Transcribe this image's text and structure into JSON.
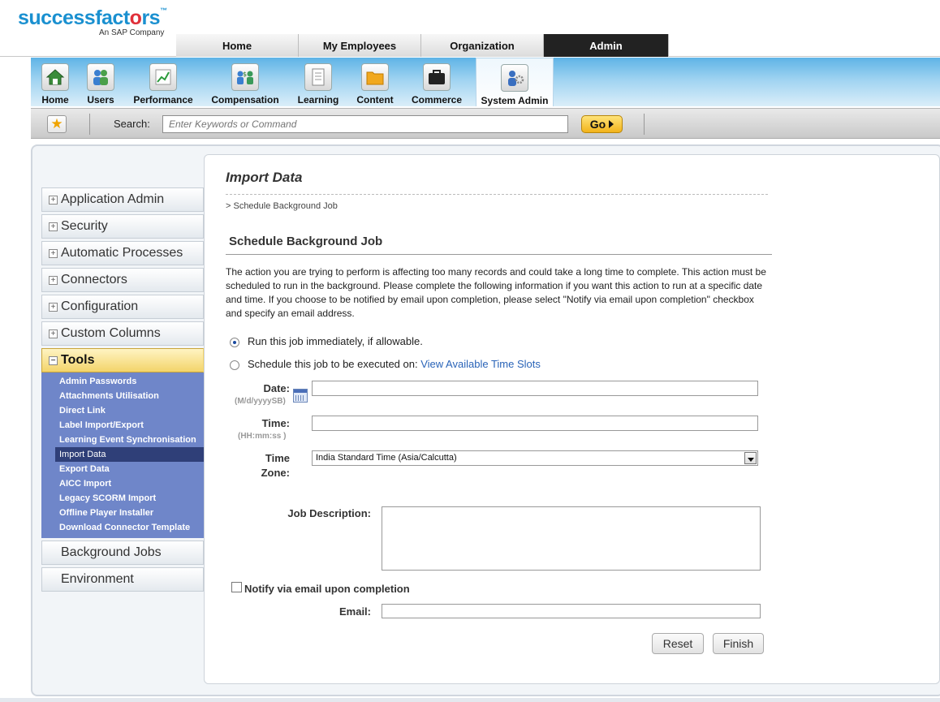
{
  "brand": {
    "logo_part1": "successfact",
    "logo_heart": "o",
    "logo_part2": "rs",
    "tm": "™",
    "sub": "An SAP Company"
  },
  "main_tabs": [
    {
      "label": "Home",
      "active": false
    },
    {
      "label": "My Employees",
      "active": false
    },
    {
      "label": "Organization",
      "active": false
    },
    {
      "label": "Admin",
      "active": true
    }
  ],
  "modules": [
    {
      "label": "Home",
      "icon": "house-icon"
    },
    {
      "label": "Users",
      "icon": "users-icon"
    },
    {
      "label": "Performance",
      "icon": "chart-icon"
    },
    {
      "label": "Compensation",
      "icon": "compensation-icon"
    },
    {
      "label": "Learning",
      "icon": "document-icon"
    },
    {
      "label": "Content",
      "icon": "folder-icon"
    },
    {
      "label": "Commerce",
      "icon": "briefcase-icon"
    },
    {
      "label": "System Admin",
      "icon": "admin-gear-icon",
      "active": true
    }
  ],
  "search": {
    "label": "Search:",
    "placeholder": "Enter Keywords or Command",
    "go_label": "Go"
  },
  "sidebar": {
    "items_top": [
      {
        "label": "Application Admin"
      },
      {
        "label": "Security"
      },
      {
        "label": "Automatic Processes"
      },
      {
        "label": "Connectors"
      },
      {
        "label": "Configuration"
      },
      {
        "label": "Custom Columns"
      }
    ],
    "expanded": {
      "label": "Tools"
    },
    "sub_items": [
      {
        "label": "Admin Passwords"
      },
      {
        "label": "Attachments Utilisation"
      },
      {
        "label": "Direct Link"
      },
      {
        "label": "Label Import/Export"
      },
      {
        "label": "Learning Event Synchronisation"
      },
      {
        "label": "Import Data",
        "active": true
      },
      {
        "label": "Export Data"
      },
      {
        "label": "AICC Import"
      },
      {
        "label": "Legacy SCORM Import"
      },
      {
        "label": "Offline Player Installer"
      },
      {
        "label": "Download Connector Template"
      }
    ],
    "items_bottom": [
      {
        "label": "Background Jobs"
      },
      {
        "label": "Environment"
      }
    ]
  },
  "page": {
    "title": "Import Data",
    "breadcrumb": "> Schedule Background Job",
    "section_title": "Schedule Background Job",
    "description": "The action you are trying to perform is affecting too many records and could take a long time to complete. This action must be scheduled to run in the background. Please complete the following information if you want this action to run at a specific date and time. If you choose to be notified by email upon completion, please select \"Notify via email upon completion\" checkbox and specify an email address.",
    "radio_immediate": "Run this job immediately, if allowable.",
    "radio_schedule": "Schedule this job to be executed on:",
    "time_slots_link": "View Available Time Slots",
    "selected_option": "immediate",
    "date_label": "Date:",
    "date_hint": "(M/d/yyyySB)",
    "date_value": "",
    "time_label": "Time:",
    "time_hint": "(HH:mm:ss )",
    "time_value": "",
    "tz_label_1": "Time",
    "tz_label_2": "Zone:",
    "tz_value": "India Standard Time (Asia/Calcutta)",
    "job_desc_label": "Job Description:",
    "job_desc_value": "",
    "notify_label": "Notify via email upon completion",
    "notify_checked": false,
    "email_label": "Email:",
    "email_value": "",
    "reset_label": "Reset",
    "finish_label": "Finish"
  },
  "colors": {
    "accent_blue": "#1a90d0",
    "nav_sub_bg": "#6f86c9",
    "tools_highlight": "#f3d46a",
    "link": "#2a64b8"
  }
}
